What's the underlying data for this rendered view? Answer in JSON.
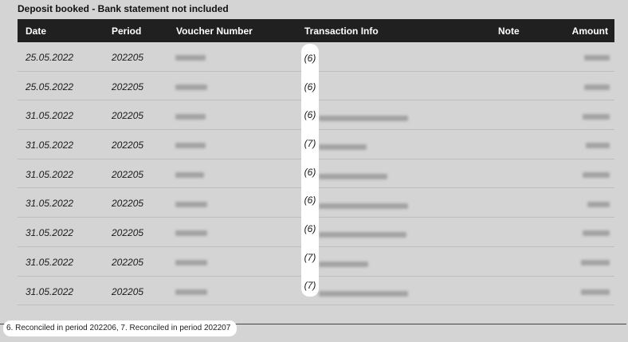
{
  "title": "Deposit booked - Bank statement not included",
  "columns": {
    "date": "Date",
    "period": "Period",
    "voucher": "Voucher Number",
    "transaction_info": "Transaction Info",
    "note": "Note",
    "amount": "Amount"
  },
  "rows": [
    {
      "date": "25.05.2022",
      "period": "202205",
      "ref": "(6)"
    },
    {
      "date": "25.05.2022",
      "period": "202205",
      "ref": "(6)"
    },
    {
      "date": "31.05.2022",
      "period": "202205",
      "ref": "(6)"
    },
    {
      "date": "31.05.2022",
      "period": "202205",
      "ref": "(7)"
    },
    {
      "date": "31.05.2022",
      "period": "202205",
      "ref": "(6)"
    },
    {
      "date": "31.05.2022",
      "period": "202205",
      "ref": "(6)"
    },
    {
      "date": "31.05.2022",
      "period": "202205",
      "ref": "(6)"
    },
    {
      "date": "31.05.2022",
      "period": "202205",
      "ref": "(7)"
    },
    {
      "date": "31.05.2022",
      "period": "202205",
      "ref": "(7)"
    }
  ],
  "footnote": "6. Reconciled in period 202206, 7. Reconciled in period 202207"
}
